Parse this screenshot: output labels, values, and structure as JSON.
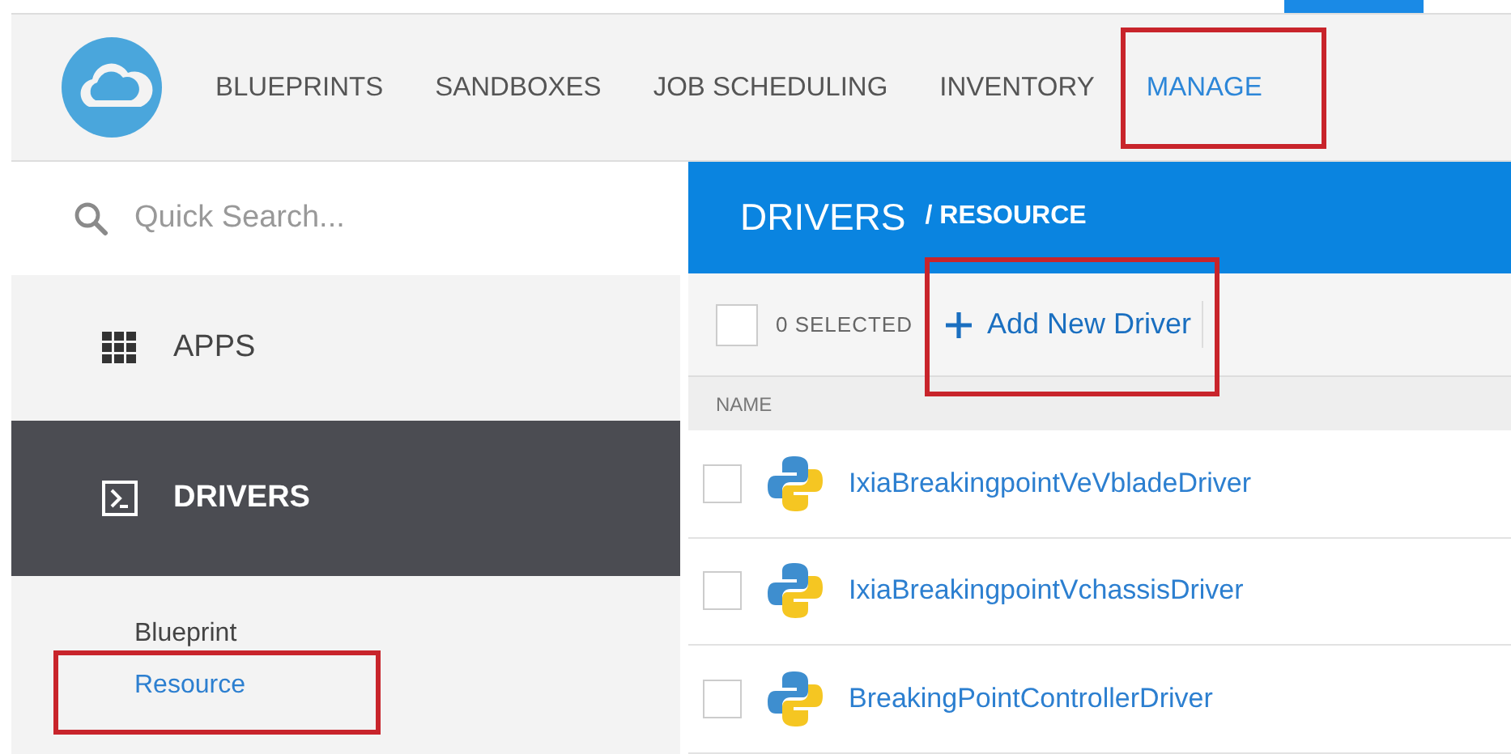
{
  "nav": [
    {
      "label": "BLUEPRINTS",
      "selected": false
    },
    {
      "label": "SANDBOXES",
      "selected": false
    },
    {
      "label": "JOB SCHEDULING",
      "selected": false
    },
    {
      "label": "INVENTORY",
      "selected": false
    },
    {
      "label": "MANAGE",
      "selected": true
    }
  ],
  "search": {
    "placeholder": "Quick Search..."
  },
  "sidebar": {
    "items": [
      {
        "label": "APPS",
        "kind": "apps",
        "selected": false
      },
      {
        "label": "DRIVERS",
        "kind": "drivers",
        "selected": true
      }
    ],
    "sub_items": [
      {
        "label": "Blueprint",
        "selected": false
      },
      {
        "label": "Resource",
        "selected": true
      }
    ]
  },
  "header": {
    "title": "DRIVERS",
    "subtitle": "/ RESOURCE"
  },
  "toolbar": {
    "select_all": false,
    "selected_count": "0 SELECTED",
    "add_button": "Add New Driver"
  },
  "table": {
    "columns": [
      "NAME"
    ],
    "rows": [
      {
        "name": "IxiaBreakingpointVeVbladeDriver",
        "checked": false
      },
      {
        "name": "IxiaBreakingpointVchassisDriver",
        "checked": false
      },
      {
        "name": "BreakingPointControllerDriver",
        "checked": false
      }
    ]
  }
}
